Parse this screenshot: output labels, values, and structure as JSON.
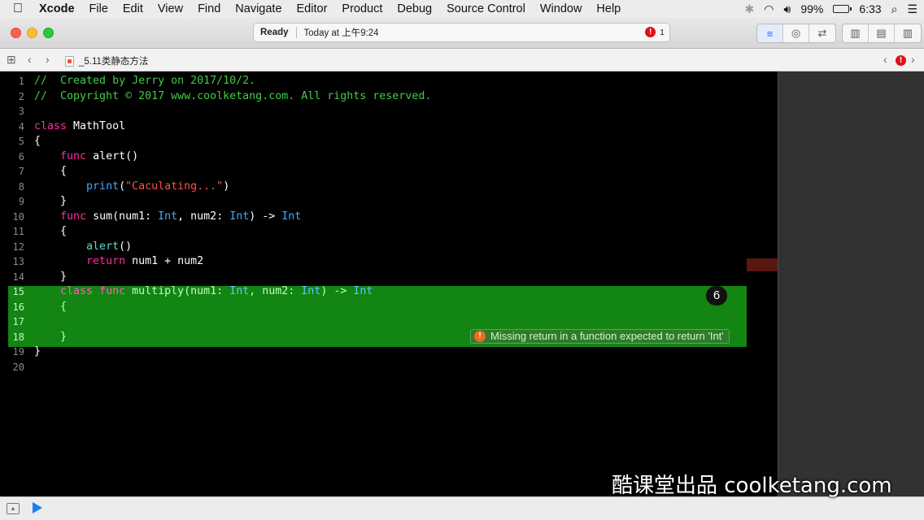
{
  "menubar": {
    "apple": "",
    "app_name": "Xcode",
    "items": [
      "File",
      "Edit",
      "View",
      "Find",
      "Navigate",
      "Editor",
      "Product",
      "Debug",
      "Source Control",
      "Window",
      "Help"
    ],
    "battery_percent": "99%",
    "time": "6:33"
  },
  "toolbar": {
    "status": "Ready",
    "timestamp": "Today at 上午9:24",
    "error_count": "1",
    "error_icon": "!"
  },
  "jumpbar": {
    "file_name": "_5.11类静态方法"
  },
  "editor": {
    "lines": [
      {
        "n": "1",
        "parts": [
          [
            "comment",
            "//  Created by Jerry on 2017/10/2."
          ]
        ]
      },
      {
        "n": "2",
        "parts": [
          [
            "comment",
            "//  Copyright © 2017 www.coolketang.com. All rights reserved."
          ]
        ]
      },
      {
        "n": "3",
        "parts": []
      },
      {
        "n": "4",
        "parts": [
          [
            "kw",
            "class"
          ],
          [
            "plain",
            " MathTool"
          ]
        ]
      },
      {
        "n": "5",
        "parts": [
          [
            "plain",
            "{"
          ]
        ]
      },
      {
        "n": "6",
        "parts": [
          [
            "plain",
            "    "
          ],
          [
            "kw",
            "func"
          ],
          [
            "plain",
            " alert()"
          ]
        ]
      },
      {
        "n": "7",
        "parts": [
          [
            "plain",
            "    {"
          ]
        ]
      },
      {
        "n": "8",
        "parts": [
          [
            "plain",
            "        "
          ],
          [
            "type",
            "print"
          ],
          [
            "plain",
            "("
          ],
          [
            "str",
            "\"Caculating...\""
          ],
          [
            "plain",
            ")"
          ]
        ]
      },
      {
        "n": "9",
        "parts": [
          [
            "plain",
            "    }"
          ]
        ]
      },
      {
        "n": "10",
        "parts": [
          [
            "plain",
            "    "
          ],
          [
            "kw",
            "func"
          ],
          [
            "plain",
            " sum(num1: "
          ],
          [
            "type",
            "Int"
          ],
          [
            "plain",
            ", num2: "
          ],
          [
            "type",
            "Int"
          ],
          [
            "plain",
            ") -> "
          ],
          [
            "type",
            "Int"
          ]
        ]
      },
      {
        "n": "11",
        "parts": [
          [
            "plain",
            "    {"
          ]
        ]
      },
      {
        "n": "12",
        "parts": [
          [
            "plain",
            "        "
          ],
          [
            "fn",
            "alert"
          ],
          [
            "plain",
            "()"
          ]
        ]
      },
      {
        "n": "13",
        "parts": [
          [
            "plain",
            "        "
          ],
          [
            "kw",
            "return"
          ],
          [
            "plain",
            " num1 + num2"
          ]
        ]
      },
      {
        "n": "14",
        "parts": [
          [
            "plain",
            "    }"
          ]
        ]
      },
      {
        "n": "15",
        "parts": [
          [
            "plain",
            "    "
          ],
          [
            "kw",
            "class"
          ],
          [
            "plain",
            " "
          ],
          [
            "kw",
            "func"
          ],
          [
            "plain",
            " multiply(num1: "
          ],
          [
            "type",
            "Int"
          ],
          [
            "plain",
            ", num2: "
          ],
          [
            "type",
            "Int"
          ],
          [
            "plain",
            ") -> "
          ],
          [
            "type",
            "Int"
          ]
        ]
      },
      {
        "n": "16",
        "parts": [
          [
            "plain",
            "    {"
          ]
        ]
      },
      {
        "n": "17",
        "parts": []
      },
      {
        "n": "18",
        "parts": [
          [
            "plain",
            "    }"
          ]
        ]
      },
      {
        "n": "19",
        "parts": [
          [
            "plain",
            "}"
          ]
        ]
      },
      {
        "n": "20",
        "parts": []
      }
    ],
    "step_badge": "6",
    "error_message": "Missing return in a function expected to return 'Int'",
    "error_icon": "!"
  },
  "watermark": "酷课堂出品 coolketang.com",
  "colors": {
    "highlight": "#128512",
    "keyword": "#ff2ea3",
    "comment": "#41cc45",
    "type": "#3faaff",
    "string": "#ff4f4a",
    "error": "#e0101b"
  },
  "icons": [
    "apple-icon",
    "bluetooth-icon",
    "wifi-icon",
    "volume-icon",
    "battery-icon",
    "search-icon",
    "list-icon",
    "close-window-icon",
    "minimize-icon",
    "zoom-icon",
    "error-icon",
    "standard-editor-icon",
    "assistant-editor-icon",
    "version-editor-icon",
    "navigator-toggle-icon",
    "debug-area-toggle-icon",
    "utilities-toggle-icon",
    "grid-icon",
    "back-icon",
    "forward-icon",
    "swift-file-icon",
    "run-icon",
    "hide-debug-icon"
  ]
}
